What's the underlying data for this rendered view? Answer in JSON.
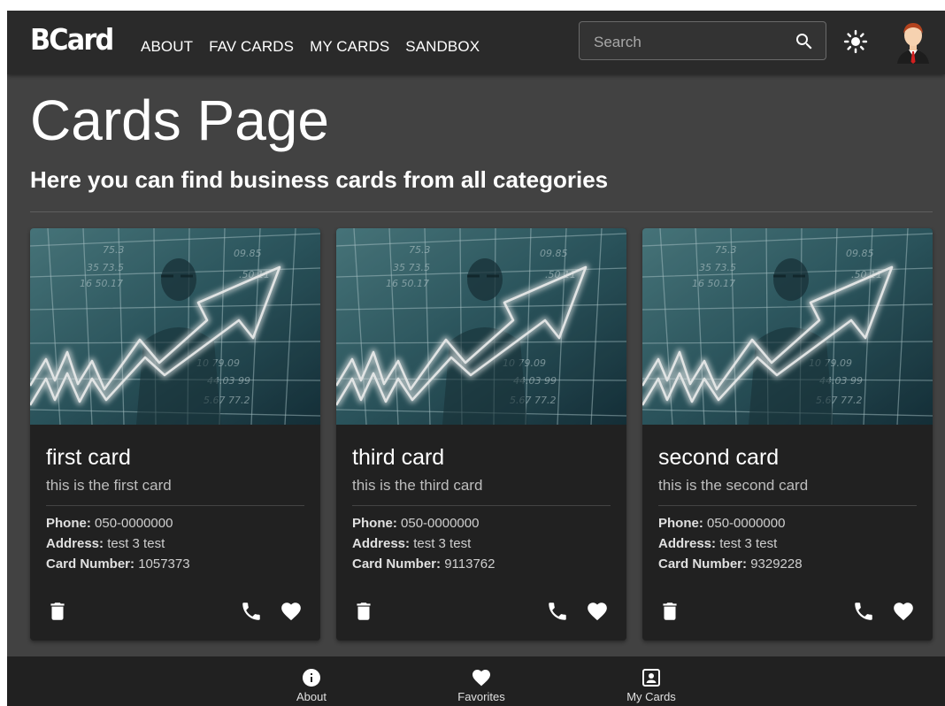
{
  "header": {
    "logo": "BCard",
    "nav": [
      "ABOUT",
      "FAV CARDS",
      "MY CARDS",
      "SANDBOX"
    ],
    "search_placeholder": "Search",
    "search_value": ""
  },
  "main": {
    "title": "Cards Page",
    "subtitle": "Here you can find business cards from all categories"
  },
  "labels": {
    "phone": "Phone:",
    "address": "Address:",
    "card_number": "Card Number:"
  },
  "cards": [
    {
      "title": "first card",
      "subtitle": "this is the first card",
      "phone": "050-0000000",
      "address": "test 3 test",
      "card_number": "1057373"
    },
    {
      "title": "third card",
      "subtitle": "this is the third card",
      "phone": "050-0000000",
      "address": "test 3 test",
      "card_number": "9113762"
    },
    {
      "title": "second card",
      "subtitle": "this is the second card",
      "phone": "050-0000000",
      "address": "test 3 test",
      "card_number": "9329228"
    }
  ],
  "bottom_nav": [
    {
      "label": "About",
      "icon": "info-icon"
    },
    {
      "label": "Favorites",
      "icon": "heart-icon"
    },
    {
      "label": "My Cards",
      "icon": "contact-card-icon"
    }
  ],
  "colors": {
    "app_background": "#424242",
    "appbar_background": "#2a2a2a",
    "card_background": "#212121",
    "bottom_nav_background": "#212121",
    "text_primary": "#ffffff",
    "text_secondary": "#bdbdbd"
  },
  "icons": {
    "search": "search-icon",
    "theme": "sun-icon",
    "avatar": "avatar-icon",
    "card_actions": [
      "trash-icon",
      "phone-icon",
      "heart-icon"
    ]
  }
}
